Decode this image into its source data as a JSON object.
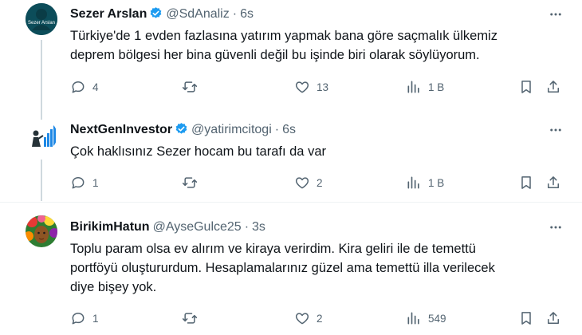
{
  "tweets": [
    {
      "name": "Sezer Arslan",
      "handle": "@SdAnaliz",
      "time": "6s",
      "avatar_label": "Sezer Arslan",
      "lines": [
        "Türkiye'de 1 evden fazlasına yatırım yapmak bana göre saçmalık ülkemiz",
        "deprem bölgesi her bina güvenli değil bu işinde biri olarak söylüyorum."
      ],
      "replies": "4",
      "retweets": "",
      "likes": "13",
      "views": "1 B"
    },
    {
      "name": "NextGenInvestor",
      "handle": "@yatirimcitogi",
      "time": "6s",
      "lines": [
        "Çok haklısınız Sezer hocam bu tarafı da var"
      ],
      "replies": "1",
      "retweets": "",
      "likes": "2",
      "views": "1 B"
    },
    {
      "name": "BirikimHatun",
      "handle": "@AyseGulce25",
      "time": "3s",
      "lines": [
        "Toplu param olsa ev alırım ve kiraya verirdim. Kira geliri ile de temettü",
        "portföyü oluştururdum. Hesaplamalarınız  güzel ama temettü illa verilecek",
        "diye bişey yok."
      ],
      "replies": "1",
      "retweets": "",
      "likes": "2",
      "views": "549"
    }
  ],
  "colors": {
    "verified": "#1d9bf0",
    "secondary": "#536471",
    "text": "#0f1419"
  },
  "icons": [
    "reply-icon",
    "retweet-icon",
    "like-icon",
    "views-icon",
    "bookmark-icon",
    "share-icon",
    "more-icon",
    "verified-icon"
  ]
}
